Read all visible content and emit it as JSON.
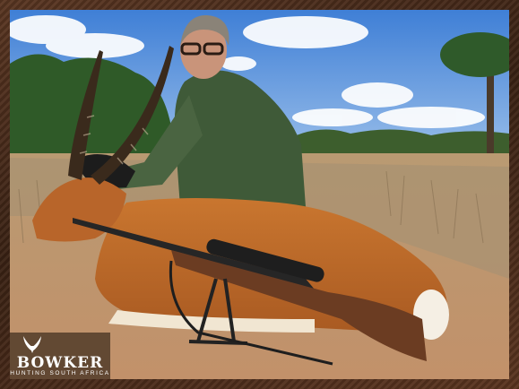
{
  "logo": {
    "brand": "BOWKER",
    "tagline": "HUNTING SOUTH AFRICA",
    "icon": "antelope-horns-icon"
  },
  "colors": {
    "frame": "#3a2214",
    "sky": "#4b86d8",
    "ground": "#c79a6b",
    "jacket": "#3f5a38",
    "antelope_coat": "#c06a2a"
  }
}
